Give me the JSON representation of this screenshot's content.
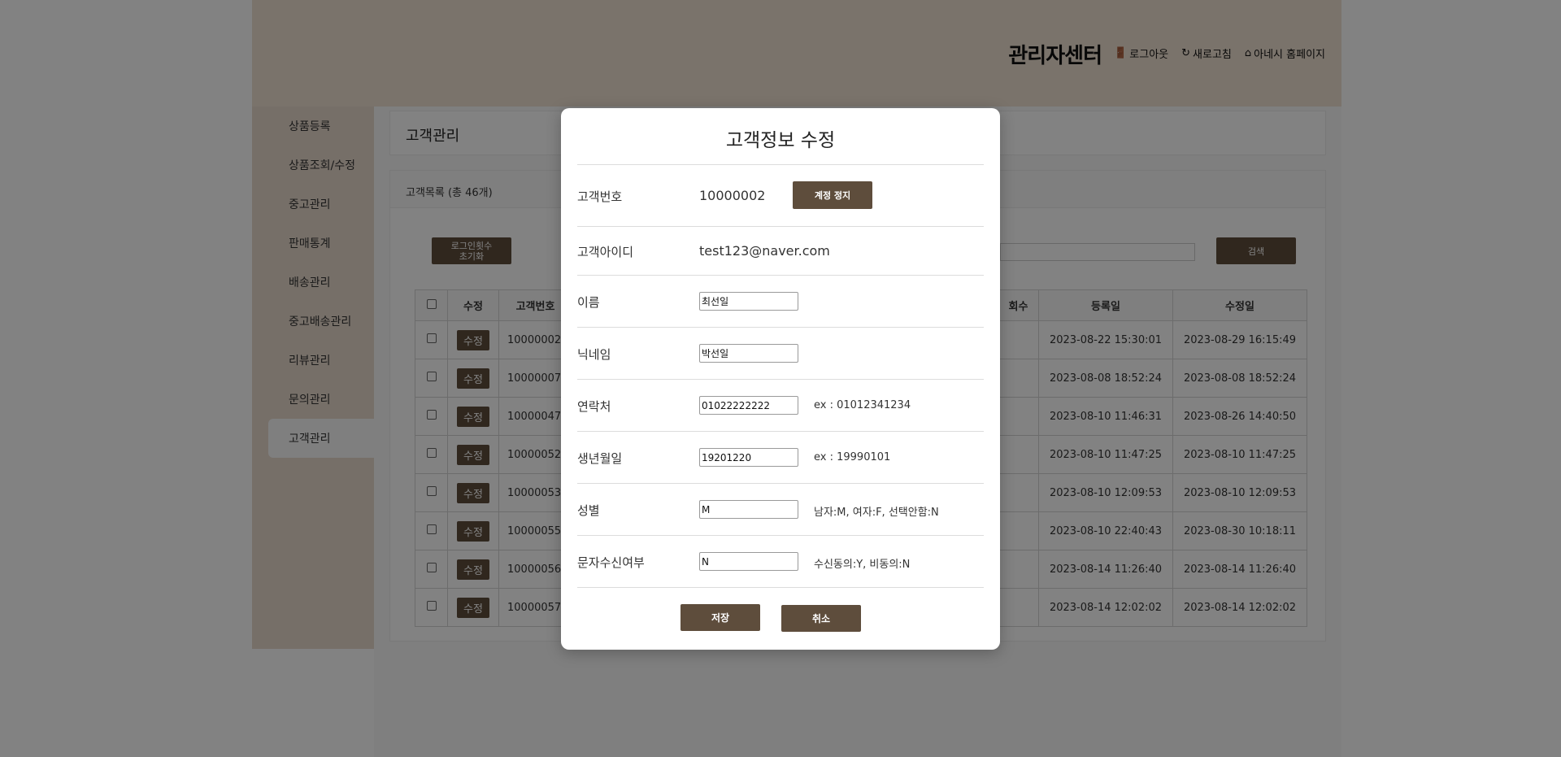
{
  "header": {
    "title": "관리자센터",
    "links": [
      "로그아웃",
      "새로고침",
      "아네시 홈페이지"
    ]
  },
  "sidebar": {
    "items": [
      "상품등록",
      "상품조회/수정",
      "중고관리",
      "판매통계",
      "배송관리",
      "중고배송관리",
      "리뷰관리",
      "문의관리",
      "고객관리"
    ],
    "active": "고객관리"
  },
  "main": {
    "title": "고객관리",
    "list_count": "고객목록 (총 46개)",
    "reset_button": "로그인횟수\n초기화",
    "search_button": "검색",
    "table": {
      "headers": {
        "edit": "수정",
        "no": "고객번호",
        "count": "회수",
        "created": "등록일",
        "updated": "수정일"
      },
      "edit_label": "수정",
      "rows": [
        {
          "no": "10000002",
          "created": "2023-08-22 15:30:01",
          "updated": "2023-08-29 16:15:49"
        },
        {
          "no": "10000007",
          "created": "2023-08-08 18:52:24",
          "updated": "2023-08-08 18:52:24"
        },
        {
          "no": "10000047",
          "created": "2023-08-10 11:46:31",
          "updated": "2023-08-26 14:40:50"
        },
        {
          "no": "10000052",
          "created": "2023-08-10 11:47:25",
          "updated": "2023-08-10 11:47:25"
        },
        {
          "no": "10000053",
          "created": "2023-08-10 12:09:53",
          "updated": "2023-08-10 12:09:53"
        },
        {
          "no": "10000055",
          "created": "2023-08-10 22:40:43",
          "updated": "2023-08-30 10:18:11"
        },
        {
          "no": "10000056",
          "created": "2023-08-14 11:26:40",
          "updated": "2023-08-14 11:26:40"
        },
        {
          "no": "10000057",
          "created": "2023-08-14 12:02:02",
          "updated": "2023-08-14 12:02:02"
        }
      ]
    }
  },
  "modal": {
    "title": "고객정보 수정",
    "customer_no": {
      "label": "고객번호",
      "value": "10000002",
      "button": "계정 정지"
    },
    "customer_id": {
      "label": "고객아이디",
      "value": "test123@naver.com"
    },
    "name": {
      "label": "이름",
      "value": "최선일"
    },
    "nickname": {
      "label": "닉네임",
      "value": "박선일"
    },
    "phone": {
      "label": "연락처",
      "value": "01022222222",
      "hint": "ex : 01012341234"
    },
    "birth": {
      "label": "생년월일",
      "value": "19201220",
      "hint": "ex : 19990101"
    },
    "gender": {
      "label": "성별",
      "value": "M",
      "hint": "남자:M, 여자:F, 선택안함:N"
    },
    "sms": {
      "label": "문자수신여부",
      "value": "N",
      "hint": "수신동의:Y, 비동의:N"
    },
    "save_button": "저장",
    "cancel_button": "취소"
  },
  "colors": {
    "brand": "#5e4d3c",
    "header_bg": "#efe1d2",
    "sidebar_bg": "#e7dacd"
  }
}
